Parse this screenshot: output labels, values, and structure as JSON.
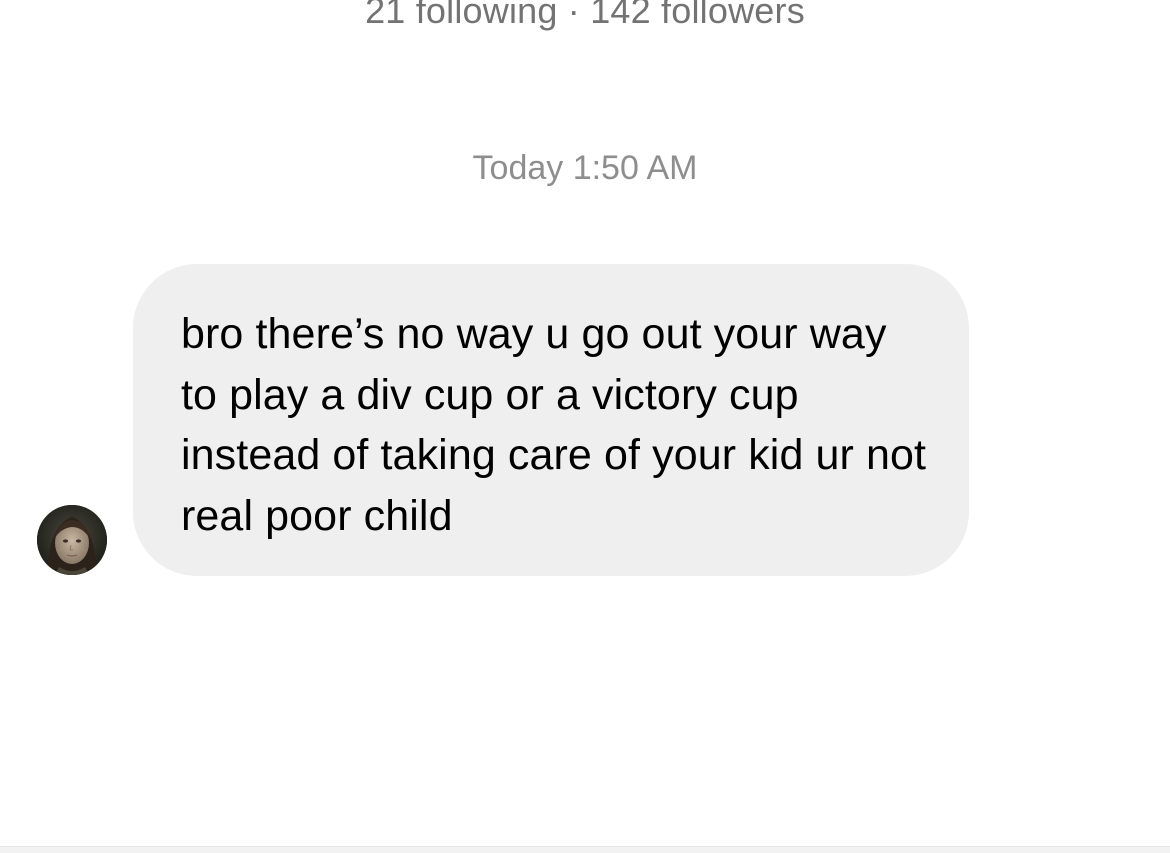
{
  "profile": {
    "stats_text": "21 following · 142 followers"
  },
  "thread": {
    "timestamp": "Today 1:50 AM",
    "messages": [
      {
        "sender": "other",
        "text": "bro there’s no way u go out your way to play a div cup or a victory cup instead of taking care of your kid ur not real poor child"
      }
    ]
  },
  "colors": {
    "background": "#ffffff",
    "bubble_incoming": "#efefef",
    "meta_text": "#8e8e8e",
    "message_text": "#000000"
  },
  "icons": {
    "sender_avatar": "profile-avatar"
  }
}
